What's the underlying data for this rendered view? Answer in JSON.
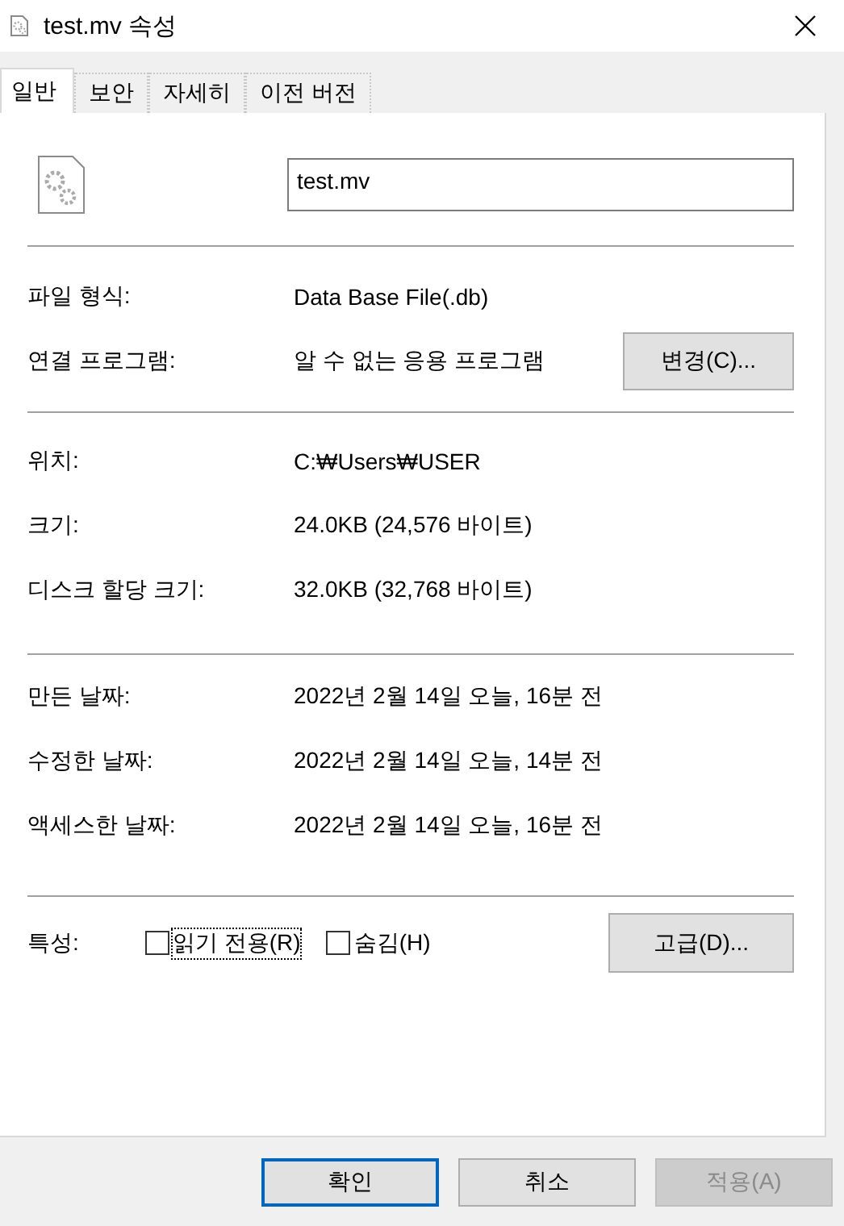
{
  "window": {
    "title": "test.mv 속성"
  },
  "tabs": [
    {
      "label": "일반",
      "selected": true
    },
    {
      "label": "보안",
      "selected": false
    },
    {
      "label": "자세히",
      "selected": false
    },
    {
      "label": "이전 버전",
      "selected": false
    }
  ],
  "file_name": {
    "value": "test.mv"
  },
  "sections": [
    [
      {
        "label": "파일 형식:",
        "value": "Data Base File(.db)"
      },
      {
        "label": "연결 프로그램:",
        "value": "알 수 없는 응용 프로그램",
        "button": "변경(C)..."
      }
    ],
    [
      {
        "label": "위치:",
        "value": "C:₩Users₩USER"
      },
      {
        "label": "크기:",
        "value": "24.0KB (24,576 바이트)"
      },
      {
        "label": "디스크 할당 크기:",
        "value": "32.0KB (32,768 바이트)"
      }
    ],
    [
      {
        "label": "만든 날짜:",
        "value": "2022년 2월 14일 오늘, 16분 전"
      },
      {
        "label": "수정한 날짜:",
        "value": "2022년 2월 14일 오늘, 14분 전"
      },
      {
        "label": "액세스한 날짜:",
        "value": "2022년 2월 14일 오늘, 16분 전"
      }
    ]
  ],
  "attributes": {
    "label": "특성:",
    "checkboxes": [
      {
        "label": "읽기 전용(R)",
        "checked": false,
        "focused": true
      },
      {
        "label": "숨김(H)",
        "checked": false,
        "focused": false
      }
    ],
    "button": "고급(D)..."
  },
  "buttons": [
    {
      "label": "확인",
      "default": true,
      "disabled": false
    },
    {
      "label": "취소",
      "default": false,
      "disabled": false
    },
    {
      "label": "적용(A)",
      "default": false,
      "disabled": true
    }
  ]
}
